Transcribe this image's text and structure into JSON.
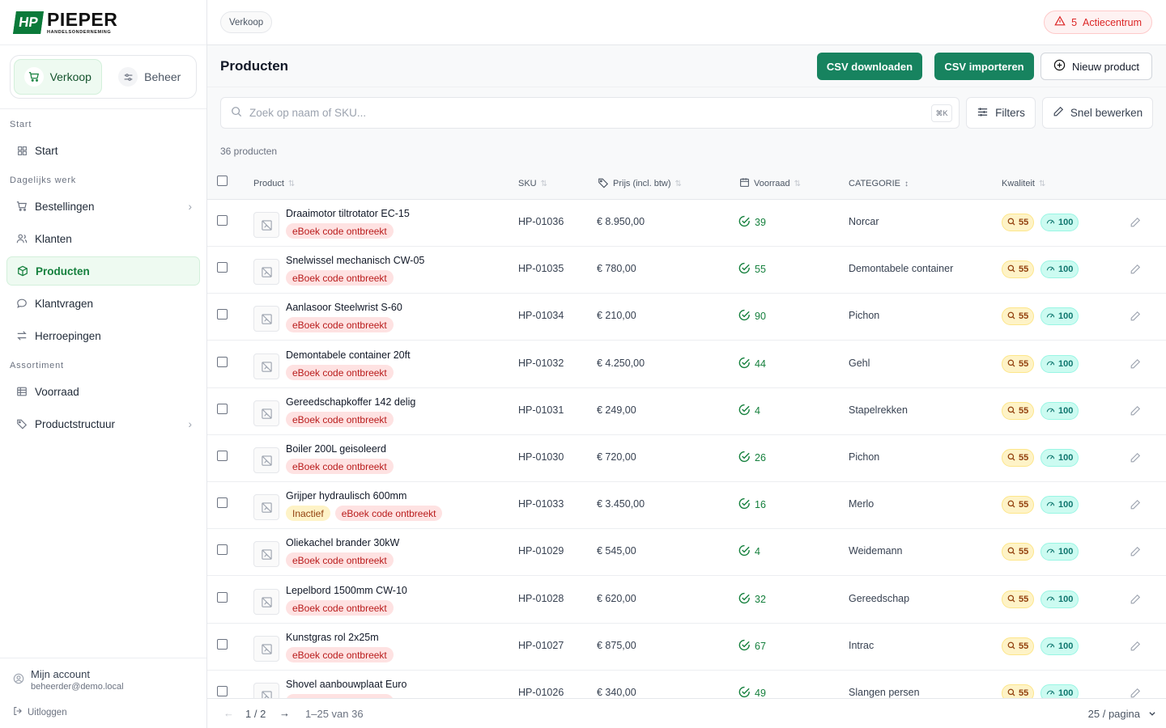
{
  "brand": {
    "name": "PIEPER",
    "subtitle": "HANDELSONDERNEMING"
  },
  "switcher": {
    "sales": "Verkoop",
    "manage": "Beheer"
  },
  "sidebar": {
    "sections": {
      "start": "Start",
      "daily": "Dagelijks werk",
      "assortment": "Assortiment"
    },
    "items": {
      "start": "Start",
      "orders": "Bestellingen",
      "customers": "Klanten",
      "products": "Producten",
      "questions": "Klantvragen",
      "returns": "Herroepingen",
      "stock": "Voorraad",
      "structure": "Productstructuur"
    }
  },
  "account": {
    "name": "Mijn account",
    "email": "beheerder@demo.local",
    "logout": "Uitloggen"
  },
  "topbar": {
    "breadcrumb": "Verkoop",
    "action_count": "5",
    "action_label": "Actiecentrum"
  },
  "header": {
    "title": "Producten",
    "csv_download": "CSV downloaden",
    "csv_import": "CSV importeren",
    "new_product": "Nieuw product"
  },
  "toolbar": {
    "search_placeholder": "Zoek op naam of SKU...",
    "kbd": "⌘K",
    "filters": "Filters",
    "quick_edit": "Snel bewerken"
  },
  "count_label": "36 producten",
  "columns": {
    "product": "Product",
    "sku": "SKU",
    "price": "Prijs (incl. btw)",
    "stock": "Voorraad",
    "category": "CATEGORIE",
    "quality": "Kwaliteit"
  },
  "rows": [
    {
      "name": "Draaimotor tiltrotator EC-15",
      "tags": [
        "eBoek code ontbreekt"
      ],
      "sku": "HP-01036",
      "price": "€ 8.950,00",
      "stock": "39",
      "category": "Norcar",
      "q1": "55",
      "q2": "100"
    },
    {
      "name": "Snelwissel mechanisch CW-05",
      "tags": [
        "eBoek code ontbreekt"
      ],
      "sku": "HP-01035",
      "price": "€ 780,00",
      "stock": "55",
      "category": "Demontabele container",
      "q1": "55",
      "q2": "100"
    },
    {
      "name": "Aanlasoor Steelwrist S-60",
      "tags": [
        "eBoek code ontbreekt"
      ],
      "sku": "HP-01034",
      "price": "€ 210,00",
      "stock": "90",
      "category": "Pichon",
      "q1": "55",
      "q2": "100"
    },
    {
      "name": "Demontabele container 20ft",
      "tags": [
        "eBoek code ontbreekt"
      ],
      "sku": "HP-01032",
      "price": "€ 4.250,00",
      "stock": "44",
      "category": "Gehl",
      "q1": "55",
      "q2": "100"
    },
    {
      "name": "Gereedschapkoffer 142 delig",
      "tags": [
        "eBoek code ontbreekt"
      ],
      "sku": "HP-01031",
      "price": "€ 249,00",
      "stock": "4",
      "category": "Stapelrekken",
      "q1": "55",
      "q2": "100"
    },
    {
      "name": "Boiler 200L geisoleerd",
      "tags": [
        "eBoek code ontbreekt"
      ],
      "sku": "HP-01030",
      "price": "€ 720,00",
      "stock": "26",
      "category": "Pichon",
      "q1": "55",
      "q2": "100"
    },
    {
      "name": "Grijper hydraulisch 600mm",
      "tags": [
        "Inactief",
        "eBoek code ontbreekt"
      ],
      "sku": "HP-01033",
      "price": "€ 3.450,00",
      "stock": "16",
      "category": "Merlo",
      "q1": "55",
      "q2": "100"
    },
    {
      "name": "Oliekachel brander 30kW",
      "tags": [
        "eBoek code ontbreekt"
      ],
      "sku": "HP-01029",
      "price": "€ 545,00",
      "stock": "4",
      "category": "Weidemann",
      "q1": "55",
      "q2": "100"
    },
    {
      "name": "Lepelbord 1500mm CW-10",
      "tags": [
        "eBoek code ontbreekt"
      ],
      "sku": "HP-01028",
      "price": "€ 620,00",
      "stock": "32",
      "category": "Gereedschap",
      "q1": "55",
      "q2": "100"
    },
    {
      "name": "Kunstgras rol 2x25m",
      "tags": [
        "eBoek code ontbreekt"
      ],
      "sku": "HP-01027",
      "price": "€ 875,00",
      "stock": "67",
      "category": "Intrac",
      "q1": "55",
      "q2": "100"
    },
    {
      "name": "Shovel aanbouwplaat Euro",
      "tags": [
        "eBoek code ontbreekt"
      ],
      "sku": "HP-01026",
      "price": "€ 340,00",
      "stock": "49",
      "category": "Slangen persen",
      "q1": "55",
      "q2": "100"
    }
  ],
  "pager": {
    "page": "1 / 2",
    "range": "1–25 van 36",
    "per_page": "25 / pagina"
  }
}
